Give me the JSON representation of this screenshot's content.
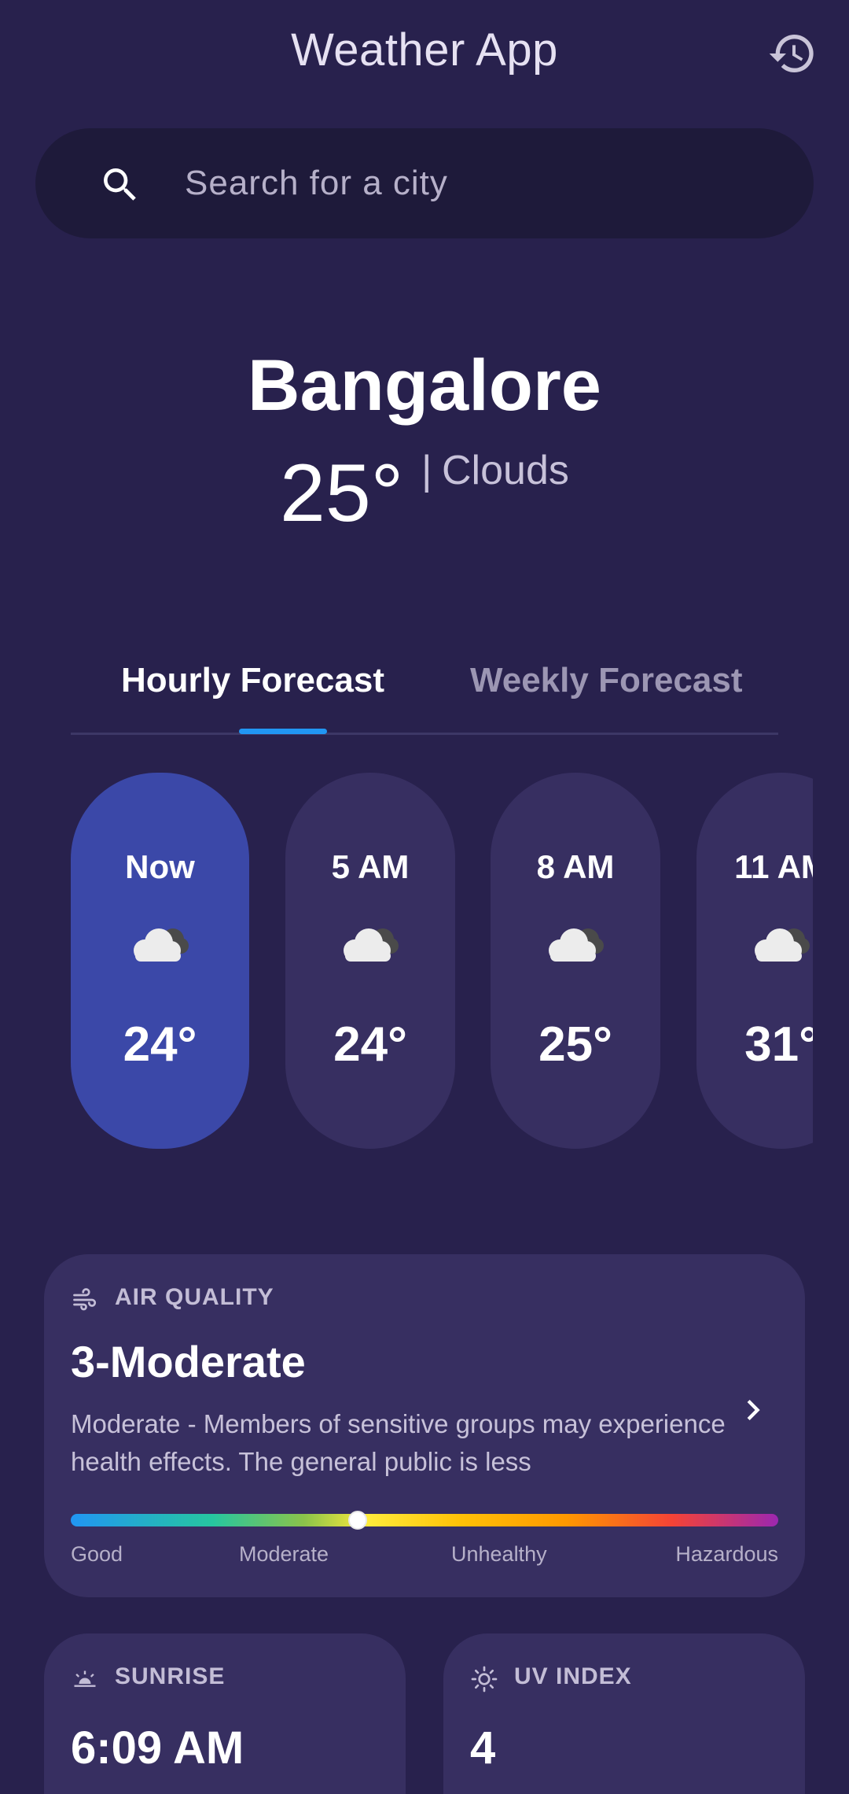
{
  "header": {
    "title": "Weather App",
    "history_icon": "history-icon"
  },
  "search": {
    "placeholder": "Search for a city",
    "value": "",
    "icon": "search-icon"
  },
  "current": {
    "city": "Bangalore",
    "temperature": "25°",
    "separator": "|",
    "condition": "Clouds"
  },
  "tabs": [
    {
      "label": "Hourly Forecast",
      "active": true
    },
    {
      "label": "Weekly Forecast",
      "active": false
    }
  ],
  "hourly": [
    {
      "time": "Now",
      "icon": "cloud-icon",
      "temp": "24°",
      "active": true
    },
    {
      "time": "5 AM",
      "icon": "cloud-icon",
      "temp": "24°",
      "active": false
    },
    {
      "time": "8 AM",
      "icon": "cloud-icon",
      "temp": "25°",
      "active": false
    },
    {
      "time": "11 AM",
      "icon": "cloud-icon",
      "temp": "31°",
      "active": false
    }
  ],
  "air_quality": {
    "header": "AIR QUALITY",
    "icon": "wind-icon",
    "title": "3-Moderate",
    "description": "Moderate - Members of sensitive groups may experience health effects. The general public is less",
    "scale_position": 0.405,
    "scale_labels": [
      "Good",
      "Moderate",
      "Unhealthy",
      "Hazardous"
    ],
    "chevron_icon": "chevron-right-icon"
  },
  "sunrise": {
    "header": "SUNRISE",
    "icon": "sunrise-icon",
    "value": "6:09 AM"
  },
  "uv_index": {
    "header": "UV INDEX",
    "icon": "sun-icon",
    "value": "4"
  },
  "colors": {
    "background": "#28214d",
    "card": "#372f61",
    "active_card": "#3b48a8",
    "tab_indicator": "#2196f3",
    "search_bg": "#1e1a3a"
  }
}
